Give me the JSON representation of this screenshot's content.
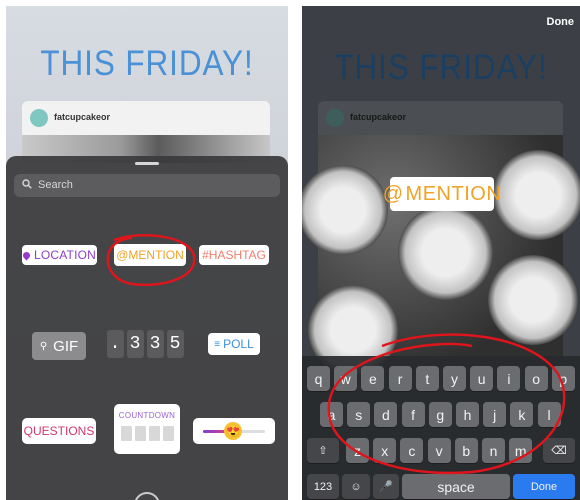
{
  "left_screen": {
    "headline": "THIS FRIDAY!",
    "post_username": "fatcupcakeor",
    "search_placeholder": "Search",
    "stickers": {
      "location": "LOCATION",
      "mention": "@MENTION",
      "hashtag": "#HASHTAG",
      "gif": "GIF",
      "time_digits": [
        ".",
        "3",
        "3",
        "5"
      ],
      "poll": "POLL",
      "questions": "QUESTIONS",
      "countdown": "COUNTDOWN",
      "slider_emoji": "😍"
    }
  },
  "right_screen": {
    "done_top": "Done",
    "headline": "THIS FRIDAY!",
    "post_username": "fatcupcakeor",
    "mention_text": "@MENTION",
    "keyboard": {
      "row1": [
        "q",
        "w",
        "e",
        "r",
        "t",
        "y",
        "u",
        "i",
        "o",
        "p"
      ],
      "row2": [
        "a",
        "s",
        "d",
        "f",
        "g",
        "h",
        "j",
        "k",
        "l"
      ],
      "row3": [
        "z",
        "x",
        "c",
        "v",
        "b",
        "n",
        "m"
      ],
      "numbers_key": "123",
      "space_key": "space",
      "done_key": "Done"
    }
  },
  "colors": {
    "annotation_red": "#e0151b",
    "instagram_blue": "#4a91d6",
    "mention_orange": "#f0a326",
    "keyboard_done_blue": "#2a7bf0"
  }
}
